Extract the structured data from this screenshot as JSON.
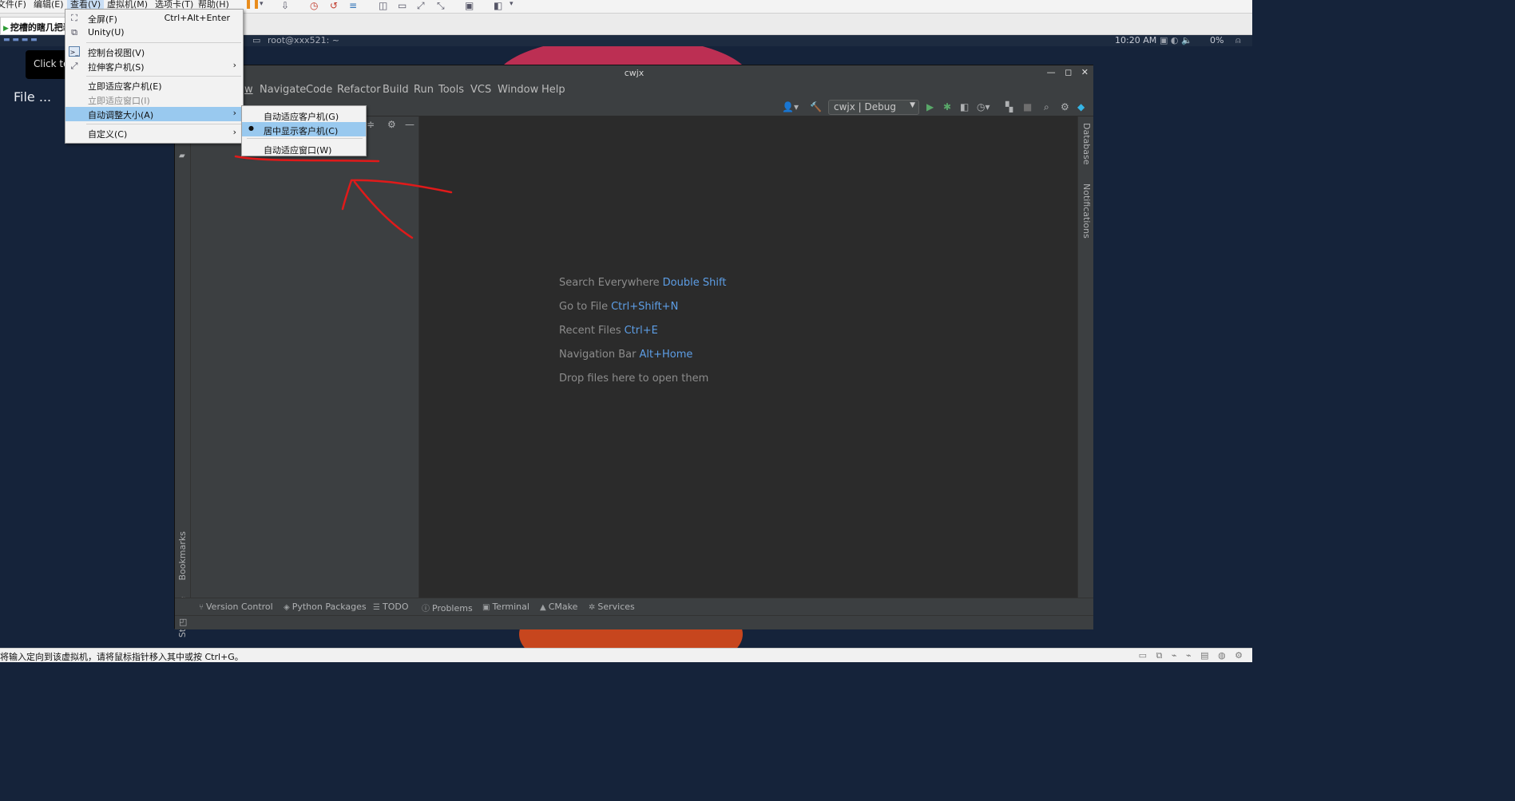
{
  "host": {
    "menus": [
      "文件(F)",
      "编辑(E)",
      "查看(V)",
      "虚拟机(M)",
      "选项卡(T)",
      "帮助(H)"
    ],
    "vm_tab_label": "挖槽的瞎几把装",
    "status_text": "将输入定向到该虚拟机，请将鼠标指针移入其中或按 Ctrl+G。"
  },
  "view_menu": {
    "items": [
      {
        "label": "全屏(F)",
        "shortcut": "Ctrl+Alt+Enter"
      },
      {
        "label": "Unity(U)"
      },
      {
        "label": "控制台视图(V)"
      },
      {
        "label": "拉伸客户机(S)"
      },
      {
        "label": "立即适应客户机(E)"
      },
      {
        "label": "立即适应窗口(I)"
      },
      {
        "label": "自动调整大小(A)"
      },
      {
        "label": "自定义(C)"
      }
    ],
    "submenu": [
      {
        "label": "自动适应客户机(G)"
      },
      {
        "label": "居中显示客户机(C)"
      },
      {
        "label": "自动适应窗口(W)"
      }
    ]
  },
  "guest": {
    "terminal_title": "root@xxx521: ~",
    "clock": "10:20 AM",
    "battery": "0%",
    "tooltip": "Click to",
    "desktop_file": "File ..."
  },
  "ide": {
    "title": "cwjx",
    "menus": [
      "w",
      "Navigate",
      "Code",
      "Refactor",
      "Build",
      "Run",
      "Tools",
      "VCS",
      "Window",
      "Help"
    ],
    "run_config": "cwjx | Debug",
    "hints": [
      {
        "label": "Search Everywhere",
        "key": "Double Shift"
      },
      {
        "label": "Go to File",
        "key": "Ctrl+Shift+N"
      },
      {
        "label": "Recent Files",
        "key": "Ctrl+E"
      },
      {
        "label": "Navigation Bar",
        "key": "Alt+Home"
      },
      {
        "label": "Drop files here to open them",
        "key": ""
      }
    ],
    "left_stripe": {
      "bookmarks": "Bookmarks",
      "structure": "Structure"
    },
    "right_stripe": {
      "database": "Database",
      "notifications": "Notifications"
    },
    "bottom_tabs": [
      "Version Control",
      "Python Packages",
      "TODO",
      "Problems",
      "Terminal",
      "CMake",
      "Services"
    ]
  },
  "colors": {
    "desktop_bg": "#15233a",
    "ide_editor_bg": "#2b2b2b",
    "ide_panel_bg": "#3c3f41",
    "hint_key": "#5d9ee6",
    "menu_highlight": "#99c9ef",
    "annotation_red": "#e01a1a"
  }
}
